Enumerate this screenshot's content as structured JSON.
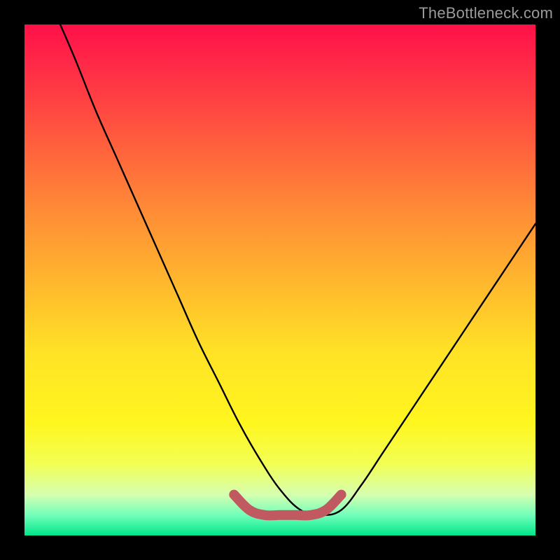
{
  "watermark": "TheBottleneck.com",
  "chart_data": {
    "type": "line",
    "title": "",
    "xlabel": "",
    "ylabel": "",
    "xlim": [
      0,
      100
    ],
    "ylim": [
      0,
      100
    ],
    "grid": false,
    "series": [
      {
        "name": "curve",
        "color": "#000000",
        "x": [
          7,
          10,
          14,
          18,
          22,
          26,
          30,
          34,
          38,
          42,
          46,
          50,
          54,
          58,
          62,
          66,
          70,
          74,
          78,
          82,
          86,
          90,
          94,
          98,
          100
        ],
        "y": [
          100,
          93,
          83,
          74,
          65,
          56,
          47,
          38,
          30,
          22,
          15,
          9,
          5,
          4,
          5,
          10,
          16,
          22,
          28,
          34,
          40,
          46,
          52,
          58,
          61
        ]
      },
      {
        "name": "highlight",
        "color": "#c05a60",
        "x": [
          41,
          44,
          47,
          50,
          53,
          56,
          59,
          62
        ],
        "y": [
          8,
          5,
          4,
          4,
          4,
          4,
          5,
          8
        ]
      }
    ]
  }
}
